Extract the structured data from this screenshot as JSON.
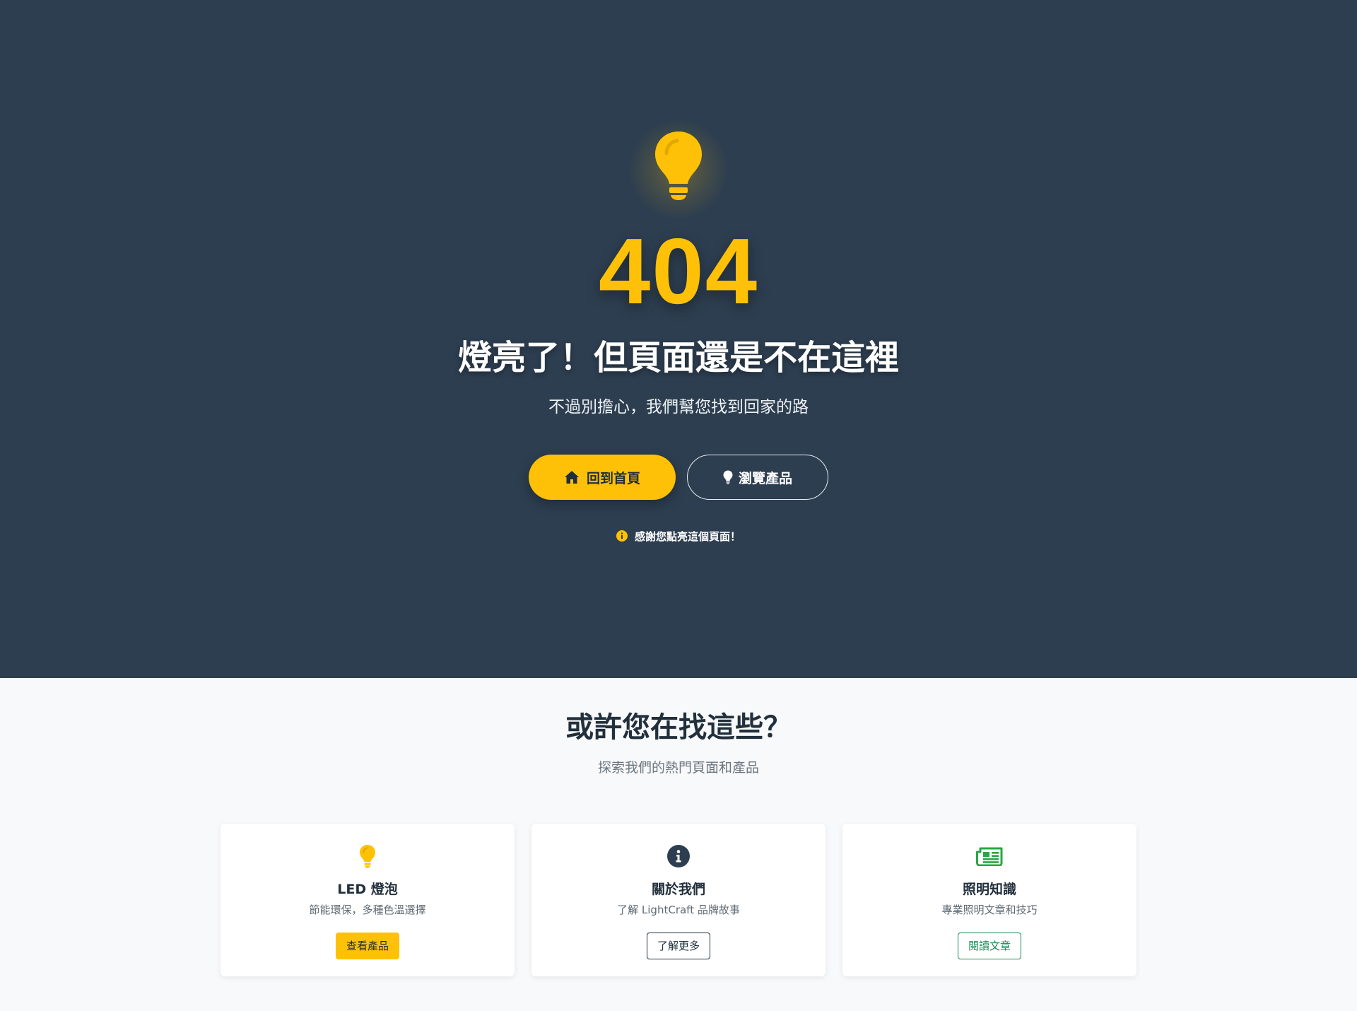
{
  "hero": {
    "error_code": "404",
    "title": "燈亮了！但頁面還是不在這裡",
    "subtitle": "不過別擔心，我們幫您找到回家的路",
    "home_button_label": "回到首頁",
    "browse_button_label": "瀏覽產品",
    "thanks_text": "感謝您點亮這個頁面！",
    "accent_color": "#ffc107",
    "background_color": "#2d3e50",
    "icons": {
      "main": "lightbulb-icon",
      "home": "home-icon",
      "browse": "lightbulb-icon",
      "thanks": "info-circle-icon"
    }
  },
  "suggestions": {
    "title": "或許您在找這些？",
    "subtitle": "探索我們的熱門頁面和產品",
    "cards": [
      {
        "icon": "lightbulb-icon",
        "icon_color": "#ffc107",
        "title": "LED 燈泡",
        "description": "節能環保，多種色溫選擇",
        "button_label": "查看產品"
      },
      {
        "icon": "info-circle-icon",
        "icon_color": "#2d3e50",
        "title": "關於我們",
        "description": "了解 LightCraft 品牌故事",
        "button_label": "了解更多"
      },
      {
        "icon": "newspaper-icon",
        "icon_color": "#28a745",
        "title": "照明知識",
        "description": "專業照明文章和技巧",
        "button_label": "閱讀文章"
      }
    ]
  }
}
